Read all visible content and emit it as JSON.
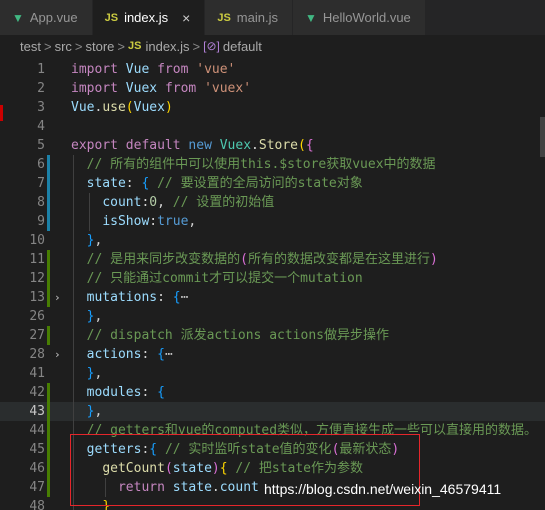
{
  "tabs": [
    {
      "icon": "vue-file-icon",
      "glyph": "▼",
      "label": "App.vue",
      "active": false
    },
    {
      "icon": "js-file-icon",
      "glyph": "JS",
      "label": "index.js",
      "active": true
    },
    {
      "icon": "js-file-icon",
      "glyph": "JS",
      "label": "main.js",
      "active": false
    },
    {
      "icon": "vue-file-icon",
      "glyph": "▼",
      "label": "HelloWorld.vue",
      "active": false
    }
  ],
  "close_glyph": "×",
  "breadcrumb": {
    "parts": [
      "test",
      "src",
      "store"
    ],
    "file": "index.js",
    "file_icon": "JS",
    "symbol_icon": "[⊘]",
    "symbol": "default",
    "separator": ">"
  },
  "editor": {
    "current_line": "43",
    "lines": [
      {
        "n": "1",
        "tokens": [
          [
            "kw",
            "import "
          ],
          [
            "var",
            "Vue "
          ],
          [
            "kw",
            "from "
          ],
          [
            "str",
            "'vue'"
          ]
        ]
      },
      {
        "n": "2",
        "tokens": [
          [
            "kw",
            "import "
          ],
          [
            "var",
            "Vuex "
          ],
          [
            "kw",
            "from "
          ],
          [
            "str",
            "'vuex'"
          ]
        ]
      },
      {
        "n": "3",
        "tokens": [
          [
            "var",
            "Vue"
          ],
          [
            "pl",
            "."
          ],
          [
            "fn",
            "use"
          ],
          [
            "br1",
            "("
          ],
          [
            "var",
            "Vuex"
          ],
          [
            "br1",
            ")"
          ]
        ]
      },
      {
        "n": "4",
        "tokens": []
      },
      {
        "n": "5",
        "tokens": [
          [
            "kw",
            "export "
          ],
          [
            "kw",
            "default "
          ],
          [
            "k2",
            "new "
          ],
          [
            "cls",
            "Vuex"
          ],
          [
            "pl",
            "."
          ],
          [
            "fn",
            "Store"
          ],
          [
            "br1",
            "("
          ],
          [
            "br2",
            "{"
          ]
        ]
      },
      {
        "n": "6",
        "tokens": [
          [
            "pl",
            "  "
          ],
          [
            "cm",
            "// 所有的组件中可以使用this.$store获取vuex中的数据"
          ]
        ]
      },
      {
        "n": "7",
        "tokens": [
          [
            "pl",
            "  "
          ],
          [
            "var",
            "state"
          ],
          [
            "pl",
            ": "
          ],
          [
            "br3",
            "{"
          ],
          [
            "pl",
            " "
          ],
          [
            "cm",
            "// 要设置的全局访问的state对象"
          ]
        ]
      },
      {
        "n": "8",
        "tokens": [
          [
            "pl",
            "    "
          ],
          [
            "var",
            "count"
          ],
          [
            "pl",
            ":"
          ],
          [
            "num",
            "0"
          ],
          [
            "pl",
            ", "
          ],
          [
            "cm",
            "// 设置的初始值"
          ]
        ]
      },
      {
        "n": "9",
        "tokens": [
          [
            "pl",
            "    "
          ],
          [
            "var",
            "isShow"
          ],
          [
            "pl",
            ":"
          ],
          [
            "k2",
            "true"
          ],
          [
            "pl",
            ","
          ]
        ]
      },
      {
        "n": "10",
        "tokens": [
          [
            "pl",
            "  "
          ],
          [
            "br3",
            "}"
          ],
          [
            "pl",
            ","
          ]
        ]
      },
      {
        "n": "11",
        "tokens": [
          [
            "pl",
            "  "
          ],
          [
            "cm",
            "// 是用来同步改变数据的"
          ],
          [
            "br2",
            "("
          ],
          [
            "cm",
            "所有的数据改变都是在这里进行"
          ],
          [
            "br2",
            ")"
          ]
        ]
      },
      {
        "n": "12",
        "tokens": [
          [
            "pl",
            "  "
          ],
          [
            "cm",
            "// 只能通过commit才可以提交一个mutation"
          ]
        ]
      },
      {
        "n": "13",
        "fold": "›",
        "tokens": [
          [
            "pl",
            "  "
          ],
          [
            "var",
            "mutations"
          ],
          [
            "pl",
            ": "
          ],
          [
            "br3",
            "{"
          ],
          [
            "ell",
            "⋯"
          ]
        ]
      },
      {
        "n": "26",
        "tokens": [
          [
            "pl",
            "  "
          ],
          [
            "br3",
            "}"
          ],
          [
            "pl",
            ","
          ]
        ]
      },
      {
        "n": "27",
        "tokens": [
          [
            "pl",
            "  "
          ],
          [
            "cm",
            "// dispatch 派发actions actions做异步操作"
          ]
        ]
      },
      {
        "n": "28",
        "fold": "›",
        "tokens": [
          [
            "pl",
            "  "
          ],
          [
            "var",
            "actions"
          ],
          [
            "pl",
            ": "
          ],
          [
            "br3",
            "{"
          ],
          [
            "ell",
            "⋯"
          ]
        ]
      },
      {
        "n": "41",
        "tokens": [
          [
            "pl",
            "  "
          ],
          [
            "br3",
            "}"
          ],
          [
            "pl",
            ","
          ]
        ]
      },
      {
        "n": "42",
        "tokens": [
          [
            "pl",
            "  "
          ],
          [
            "var",
            "modules"
          ],
          [
            "pl",
            ": "
          ],
          [
            "br3",
            "{"
          ]
        ]
      },
      {
        "n": "43",
        "tokens": [
          [
            "pl",
            "  "
          ],
          [
            "br3",
            "}"
          ],
          [
            "pl",
            ","
          ]
        ]
      },
      {
        "n": "44",
        "tokens": [
          [
            "pl",
            "  "
          ],
          [
            "cm",
            "// getters和vue的computed类似，方便直接生成一些可以直接用的数据。"
          ]
        ]
      },
      {
        "n": "45",
        "tokens": [
          [
            "pl",
            "  "
          ],
          [
            "var",
            "getters"
          ],
          [
            "pl",
            ":"
          ],
          [
            "br3",
            "{"
          ],
          [
            "pl",
            " "
          ],
          [
            "cm",
            "// 实时监听state值的变化"
          ],
          [
            "br2",
            "("
          ],
          [
            "cm",
            "最新状态"
          ],
          [
            "br2",
            ")"
          ]
        ]
      },
      {
        "n": "46",
        "tokens": [
          [
            "pl",
            "    "
          ],
          [
            "fn",
            "getCount"
          ],
          [
            "br2",
            "("
          ],
          [
            "var",
            "state"
          ],
          [
            "br2",
            ")"
          ],
          [
            "br1",
            "{"
          ],
          [
            "pl",
            " "
          ],
          [
            "cm",
            "// 把state作为参数"
          ]
        ]
      },
      {
        "n": "47",
        "tokens": [
          [
            "pl",
            "      "
          ],
          [
            "kw",
            "return "
          ],
          [
            "var",
            "state"
          ],
          [
            "pl",
            "."
          ],
          [
            "var",
            "count"
          ]
        ]
      },
      {
        "n": "48",
        "tokens": [
          [
            "pl",
            "    "
          ],
          [
            "br1",
            "}"
          ]
        ]
      }
    ]
  },
  "watermark": "https://blog.csdn.net/weixin_46579411",
  "colors": {
    "editor_bg": "#1e1e1e",
    "comment": "#6a9955",
    "keyword": "#c586c0",
    "string": "#ce9178",
    "annotation_box": "#e5262b"
  }
}
